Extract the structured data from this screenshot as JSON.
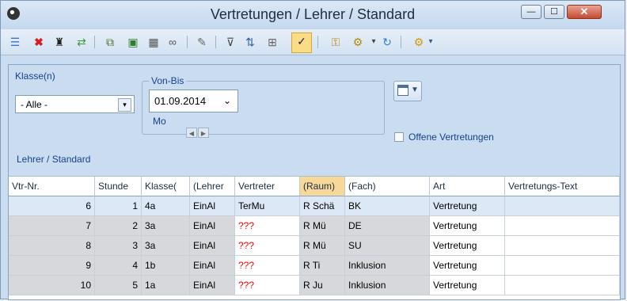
{
  "window": {
    "title": "Vertretungen / Lehrer / Standard",
    "min_label": "—",
    "max_label": "☐",
    "close_label": "✕"
  },
  "toolbar": {
    "icons": [
      "list-icon",
      "delete-icon",
      "teacher-hat-icon",
      "import-icon",
      "copy-icon",
      "export-icon",
      "calculator-icon",
      "glasses-icon",
      "wand-icon",
      "filter-icon",
      "sort-icon",
      "grid-icon",
      "edit-check-icon",
      "lock-icon",
      "document-gear-icon",
      "refresh-icon",
      "gear-icon",
      "more-icon"
    ]
  },
  "filters": {
    "klasse_label": "Klasse(n)",
    "klasse_value": "- Alle -",
    "von_bis_label": "Von-Bis",
    "date_value": "01.09.2014",
    "weekday": "Mo",
    "offene_label": "Offene Vertretungen",
    "view_label": "Lehrer / Standard"
  },
  "table": {
    "columns": [
      "Vtr-Nr.",
      "Stunde",
      "Klasse(",
      "(Lehrer",
      "Vertreter",
      "(Raum)",
      "(Fach)",
      "Art",
      "Vertretungs-Text"
    ],
    "rows": [
      {
        "vtr": "6",
        "stunde": "1",
        "klasse": "4a",
        "lehrer": "EinAl",
        "vertreter": "TerMu",
        "raum": "R Schä",
        "fach": "BK",
        "art": "Vertretung",
        "text": ""
      },
      {
        "vtr": "7",
        "stunde": "2",
        "klasse": "3a",
        "lehrer": "EinAl",
        "vertreter": "???",
        "raum": "R Mü",
        "fach": "DE",
        "art": "Vertretung",
        "text": ""
      },
      {
        "vtr": "8",
        "stunde": "3",
        "klasse": "3a",
        "lehrer": "EinAl",
        "vertreter": "???",
        "raum": "R Mü",
        "fach": "SU",
        "art": "Vertretung",
        "text": ""
      },
      {
        "vtr": "9",
        "stunde": "4",
        "klasse": "1b",
        "lehrer": "EinAl",
        "vertreter": "???",
        "raum": "R Ti",
        "fach": "Inklusion",
        "art": "Vertretung",
        "text": ""
      },
      {
        "vtr": "10",
        "stunde": "5",
        "klasse": "1a",
        "lehrer": "EinAl",
        "vertreter": "???",
        "raum": "R Ju",
        "fach": "Inklusion",
        "art": "Vertretung",
        "text": ""
      }
    ]
  },
  "colors": {
    "accent": "#15428b",
    "missing": "#ff0000",
    "raum_header": "#f8d898"
  }
}
